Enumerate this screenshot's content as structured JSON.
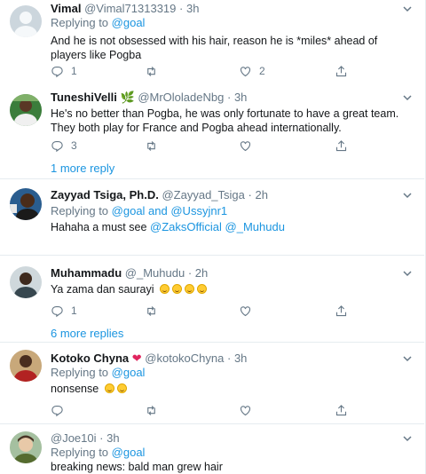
{
  "tweets": [
    {
      "name": "Vimal",
      "handle": "@Vimal71313319",
      "time": "3h",
      "replying_label": "Replying to",
      "replying_to": "@goal",
      "text": "And he is not obsessed with his hair, reason he is *miles* ahead of players like Pogba",
      "reply_count": "1",
      "retweet_count": "",
      "like_count": "2"
    },
    {
      "name": "TuneshiVelli",
      "name_emoji": "🌿",
      "handle": "@MrOloladeNbg",
      "time": "3h",
      "text": "He's no better than Pogba, he was only fortunate to have a great team. They both play for France and Pogba ahead internationally.",
      "reply_count": "3",
      "more_replies": "1 more reply"
    },
    {
      "name": "Zayyad Tsiga, Ph.D.",
      "handle": "@Zayyad_Tsiga",
      "time": "2h",
      "replying_label": "Replying to",
      "replying_to": "@goal and @Ussyjnr1",
      "text": "Hahaha a must see",
      "mention1": "@ZaksOfficial",
      "mention2": "@_Muhudu"
    },
    {
      "name": "Muhammadu",
      "handle": "@_Muhudu",
      "time": "2h",
      "text": "Ya zama dan saurayi",
      "reply_count": "1",
      "more_replies": "6 more replies"
    },
    {
      "name": "Kotoko Chyna",
      "handle": "@kotokoChyna",
      "time": "3h",
      "replying_label": "Replying to",
      "replying_to": "@goal",
      "text": "nonsense"
    },
    {
      "name": "",
      "handle": "@Joe10i",
      "time": "3h",
      "replying_label": "Replying to",
      "replying_to": "@goal",
      "text": "breaking news: bald man grew hair"
    }
  ],
  "separator": "·",
  "colors": {
    "link": "#1b95e0",
    "muted": "#657786",
    "text": "#14171a",
    "border": "#e6ecf0",
    "heart": "#e0245e"
  },
  "icons": [
    "chevron-down-icon",
    "reply-icon",
    "retweet-icon",
    "like-icon",
    "share-icon",
    "heart-emoji-icon",
    "laughing-emoji-icon"
  ]
}
